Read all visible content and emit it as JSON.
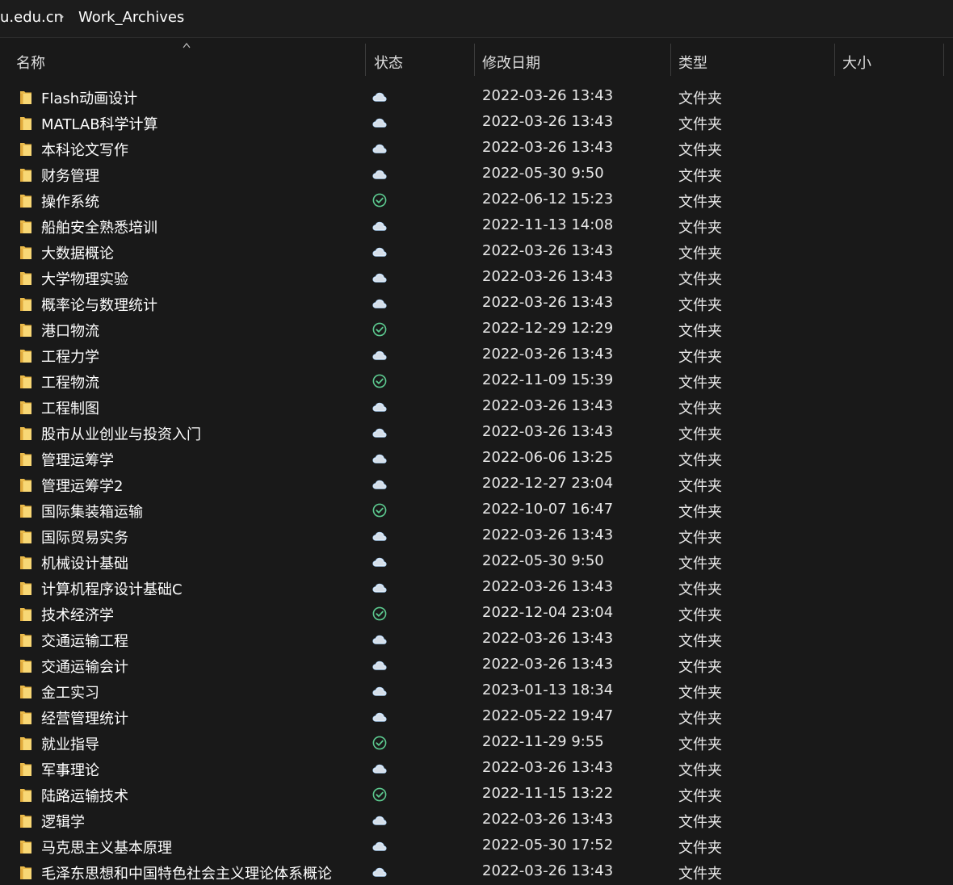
{
  "address_bar": {
    "crumbs": [
      "u.edu.cn",
      "Work_Archives"
    ],
    "separator": "›"
  },
  "columns": {
    "name": "名称",
    "status": "状态",
    "modified": "修改日期",
    "type": "类型",
    "size": "大小"
  },
  "colors": {
    "background": "#191919",
    "folder_yellow": "#f8d775",
    "synced_green": "#5cc98f",
    "cloud_blue": "#a8cdf0"
  },
  "files": [
    {
      "name": "Flash动画设计",
      "status": "cloud-icon",
      "date": "2022-03-26 13:43",
      "type": "文件夹"
    },
    {
      "name": "MATLAB科学计算",
      "status": "cloud-icon",
      "date": "2022-03-26 13:43",
      "type": "文件夹"
    },
    {
      "name": "本科论文写作",
      "status": "cloud-icon",
      "date": "2022-03-26 13:43",
      "type": "文件夹"
    },
    {
      "name": "财务管理",
      "status": "cloud-icon",
      "date": "2022-05-30 9:50",
      "type": "文件夹"
    },
    {
      "name": "操作系统",
      "status": "synced-check-icon",
      "date": "2022-06-12 15:23",
      "type": "文件夹"
    },
    {
      "name": "船舶安全熟悉培训",
      "status": "cloud-icon",
      "date": "2022-11-13 14:08",
      "type": "文件夹"
    },
    {
      "name": "大数据概论",
      "status": "cloud-icon",
      "date": "2022-03-26 13:43",
      "type": "文件夹"
    },
    {
      "name": "大学物理实验",
      "status": "cloud-icon",
      "date": "2022-03-26 13:43",
      "type": "文件夹"
    },
    {
      "name": "概率论与数理统计",
      "status": "cloud-icon",
      "date": "2022-03-26 13:43",
      "type": "文件夹"
    },
    {
      "name": "港口物流",
      "status": "synced-check-icon",
      "date": "2022-12-29 12:29",
      "type": "文件夹"
    },
    {
      "name": "工程力学",
      "status": "cloud-icon",
      "date": "2022-03-26 13:43",
      "type": "文件夹"
    },
    {
      "name": "工程物流",
      "status": "synced-check-icon",
      "date": "2022-11-09 15:39",
      "type": "文件夹"
    },
    {
      "name": "工程制图",
      "status": "cloud-icon",
      "date": "2022-03-26 13:43",
      "type": "文件夹"
    },
    {
      "name": "股市从业创业与投资入门",
      "status": "cloud-icon",
      "date": "2022-03-26 13:43",
      "type": "文件夹"
    },
    {
      "name": "管理运筹学",
      "status": "cloud-icon",
      "date": "2022-06-06 13:25",
      "type": "文件夹"
    },
    {
      "name": "管理运筹学2",
      "status": "cloud-icon",
      "date": "2022-12-27 23:04",
      "type": "文件夹"
    },
    {
      "name": "国际集装箱运输",
      "status": "synced-check-icon",
      "date": "2022-10-07 16:47",
      "type": "文件夹"
    },
    {
      "name": "国际贸易实务",
      "status": "cloud-icon",
      "date": "2022-03-26 13:43",
      "type": "文件夹"
    },
    {
      "name": "机械设计基础",
      "status": "cloud-icon",
      "date": "2022-05-30 9:50",
      "type": "文件夹"
    },
    {
      "name": "计算机程序设计基础C",
      "status": "cloud-icon",
      "date": "2022-03-26 13:43",
      "type": "文件夹"
    },
    {
      "name": "技术经济学",
      "status": "synced-check-icon",
      "date": "2022-12-04 23:04",
      "type": "文件夹"
    },
    {
      "name": "交通运输工程",
      "status": "cloud-icon",
      "date": "2022-03-26 13:43",
      "type": "文件夹"
    },
    {
      "name": "交通运输会计",
      "status": "cloud-icon",
      "date": "2022-03-26 13:43",
      "type": "文件夹"
    },
    {
      "name": "金工实习",
      "status": "cloud-icon",
      "date": "2023-01-13 18:34",
      "type": "文件夹"
    },
    {
      "name": "经营管理统计",
      "status": "cloud-icon",
      "date": "2022-05-22 19:47",
      "type": "文件夹"
    },
    {
      "name": "就业指导",
      "status": "synced-check-icon",
      "date": "2022-11-29 9:55",
      "type": "文件夹"
    },
    {
      "name": "军事理论",
      "status": "cloud-icon",
      "date": "2022-03-26 13:43",
      "type": "文件夹"
    },
    {
      "name": "陆路运输技术",
      "status": "synced-check-icon",
      "date": "2022-11-15 13:22",
      "type": "文件夹"
    },
    {
      "name": "逻辑学",
      "status": "cloud-icon",
      "date": "2022-03-26 13:43",
      "type": "文件夹"
    },
    {
      "name": "马克思主义基本原理",
      "status": "cloud-icon",
      "date": "2022-05-30 17:52",
      "type": "文件夹"
    },
    {
      "name": "毛泽东思想和中国特色社会主义理论体系概论",
      "status": "cloud-icon",
      "date": "2022-03-26 13:43",
      "type": "文件夹"
    }
  ]
}
